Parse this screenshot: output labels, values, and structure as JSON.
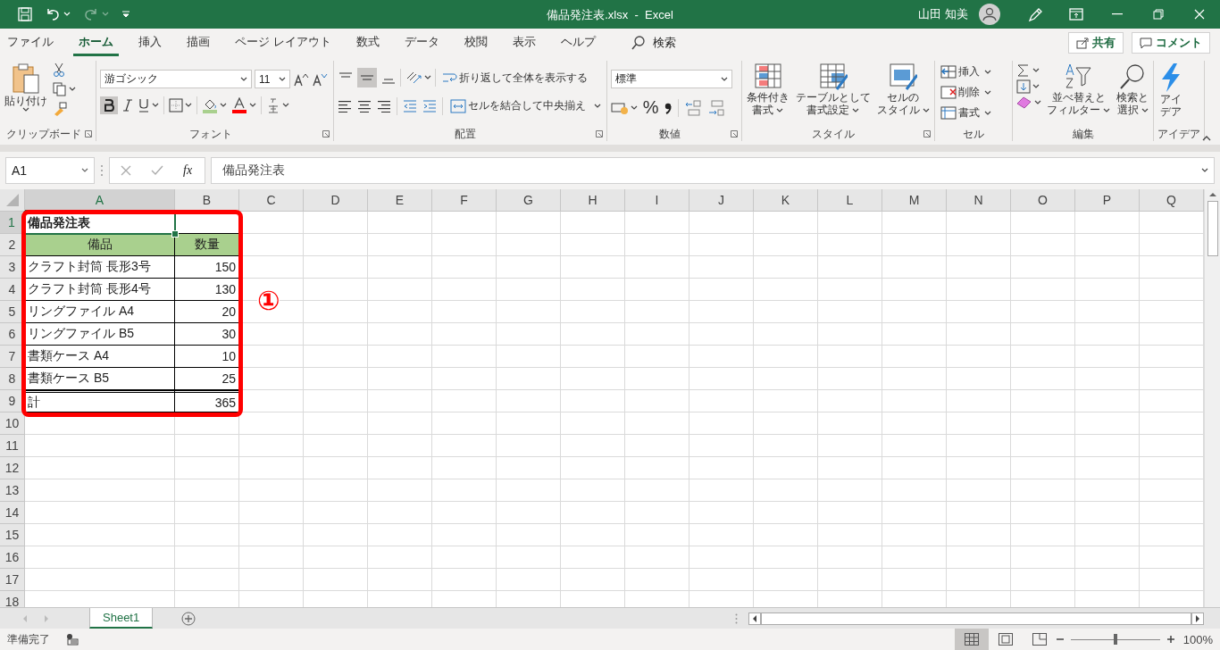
{
  "title_bar": {
    "title": "備品発注表.xlsx  -  Excel",
    "user": "山田 知美"
  },
  "menu_tabs": [
    {
      "label": "ファイル",
      "selected": false
    },
    {
      "label": "ホーム",
      "selected": true
    },
    {
      "label": "挿入",
      "selected": false
    },
    {
      "label": "描画",
      "selected": false
    },
    {
      "label": "ページ レイアウト",
      "selected": false
    },
    {
      "label": "数式",
      "selected": false
    },
    {
      "label": "データ",
      "selected": false
    },
    {
      "label": "校閲",
      "selected": false
    },
    {
      "label": "表示",
      "selected": false
    },
    {
      "label": "ヘルプ",
      "selected": false
    }
  ],
  "search": {
    "placeholder": "検索"
  },
  "share_button": "共有",
  "comment_button": "コメント",
  "ribbon": {
    "groups": [
      {
        "kind": "clipboard",
        "label": "クリップボード",
        "paste": "貼り付け"
      },
      {
        "kind": "font",
        "label": "フォント",
        "font_name": "游ゴシック",
        "font_size": "11",
        "bold": true
      },
      {
        "kind": "alignment",
        "label": "配置",
        "middle_align": true,
        "wrap_text": "折り返して全体を表示する",
        "merge": "セルを結合して中央揃え"
      },
      {
        "kind": "number",
        "label": "数値",
        "format": "標準",
        "percent": "%"
      },
      {
        "kind": "styles",
        "label": "スタイル",
        "buttons": [
          [
            "条件付き",
            "書式"
          ],
          [
            "テーブルとして",
            "書式設定"
          ],
          [
            "セルの",
            "スタイル"
          ]
        ]
      },
      {
        "kind": "cells",
        "label": "セル",
        "items": [
          "挿入",
          "削除",
          "書式"
        ]
      },
      {
        "kind": "editing",
        "label": "編集",
        "buttons": [
          [
            "並べ替えと",
            "フィルター"
          ],
          [
            "検索と",
            "選択"
          ]
        ]
      },
      {
        "kind": "ideas",
        "label": "アイデア",
        "lines": [
          "アイ",
          "デア"
        ]
      }
    ]
  },
  "formula_bar": {
    "name_box": "A1",
    "function_label": "fx",
    "formula": "備品発注表"
  },
  "columns": [
    {
      "label": "A",
      "selected": true
    },
    {
      "label": "B",
      "selected": false
    },
    {
      "label": "C",
      "selected": false
    },
    {
      "label": "D",
      "selected": false
    },
    {
      "label": "E",
      "selected": false
    },
    {
      "label": "F",
      "selected": false
    },
    {
      "label": "G",
      "selected": false
    },
    {
      "label": "H",
      "selected": false
    },
    {
      "label": "I",
      "selected": false
    },
    {
      "label": "J",
      "selected": false
    },
    {
      "label": "K",
      "selected": false
    },
    {
      "label": "L",
      "selected": false
    },
    {
      "label": "M",
      "selected": false
    },
    {
      "label": "N",
      "selected": false
    },
    {
      "label": "O",
      "selected": false
    },
    {
      "label": "P",
      "selected": false
    },
    {
      "label": "Q",
      "selected": false
    }
  ],
  "rows": [
    {
      "label": "1",
      "selected": true,
      "kind": "plain",
      "cells": [
        {
          "kind": "title",
          "text": "備品発注表"
        }
      ]
    },
    {
      "label": "2",
      "selected": false,
      "kind": "plain",
      "cells": [
        {
          "kind": "header",
          "text": "備品"
        },
        {
          "kind": "header",
          "text": "数量"
        }
      ]
    },
    {
      "label": "3",
      "selected": false,
      "kind": "plain",
      "cells": [
        {
          "kind": "text",
          "text": "クラフト封筒 長形3号"
        },
        {
          "kind": "number",
          "text": "150"
        }
      ]
    },
    {
      "label": "4",
      "selected": false,
      "kind": "plain",
      "cells": [
        {
          "kind": "text",
          "text": "クラフト封筒 長形4号"
        },
        {
          "kind": "number",
          "text": "130"
        }
      ]
    },
    {
      "label": "5",
      "selected": false,
      "kind": "plain",
      "cells": [
        {
          "kind": "text",
          "text": "リングファイル A4"
        },
        {
          "kind": "number",
          "text": "20"
        }
      ]
    },
    {
      "label": "6",
      "selected": false,
      "kind": "plain",
      "cells": [
        {
          "kind": "text",
          "text": "リングファイル B5"
        },
        {
          "kind": "number",
          "text": "30"
        }
      ]
    },
    {
      "label": "7",
      "selected": false,
      "kind": "plain",
      "cells": [
        {
          "kind": "text",
          "text": "書類ケース A4"
        },
        {
          "kind": "number",
          "text": "10"
        }
      ]
    },
    {
      "label": "8",
      "selected": false,
      "kind": "plain",
      "cells": [
        {
          "kind": "text",
          "text": "書類ケース B5"
        },
        {
          "kind": "number",
          "text": "25"
        }
      ]
    },
    {
      "label": "9",
      "selected": false,
      "kind": "total",
      "cells": [
        {
          "kind": "text",
          "text": "計"
        },
        {
          "kind": "number",
          "text": "365"
        }
      ]
    },
    {
      "label": "10",
      "selected": false,
      "kind": "plain",
      "cells": []
    },
    {
      "label": "11",
      "selected": false,
      "kind": "plain",
      "cells": []
    },
    {
      "label": "12",
      "selected": false,
      "kind": "plain",
      "cells": []
    },
    {
      "label": "13",
      "selected": false,
      "kind": "plain",
      "cells": []
    },
    {
      "label": "14",
      "selected": false,
      "kind": "plain",
      "cells": []
    },
    {
      "label": "15",
      "selected": false,
      "kind": "plain",
      "cells": []
    },
    {
      "label": "16",
      "selected": false,
      "kind": "plain",
      "cells": []
    },
    {
      "label": "17",
      "selected": false,
      "kind": "plain",
      "cells": []
    },
    {
      "label": "18",
      "selected": false,
      "kind": "plain",
      "cells": []
    }
  ],
  "annotation": {
    "label": "①"
  },
  "sheet_tabs": [
    {
      "label": "Sheet1",
      "selected": true
    }
  ],
  "status_bar": {
    "status": "準備完了",
    "zoom": "100%",
    "zoom_slider": {
      "level": 0.5
    }
  }
}
